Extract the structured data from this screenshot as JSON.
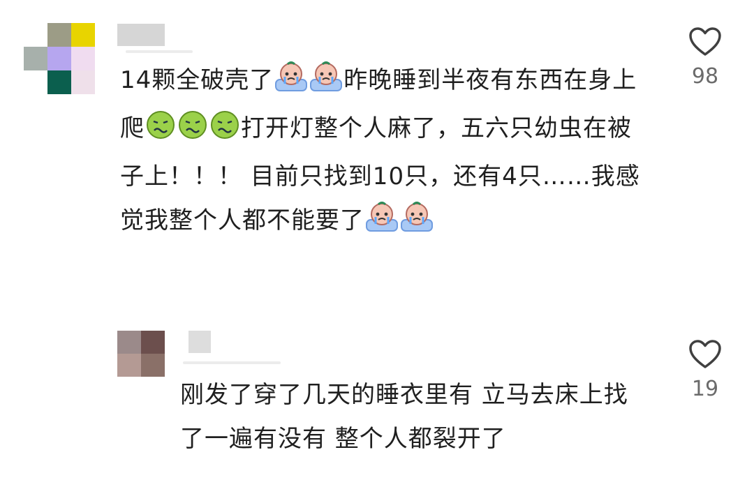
{
  "comments": [
    {
      "text_parts": [
        "14颗全破壳了",
        "昨晚睡到半夜有东西在身上爬",
        "打开灯整个人麻了，五六只幼虫在被子上！！！ 目前只找到10只，还有4只……我感觉我整个人都不能要了"
      ],
      "like_count": "98",
      "icons": {
        "emoji_a": "crying-baby-emoji",
        "emoji_b": "nauseated-face-emoji",
        "like": "heart-outline-icon"
      },
      "colors": {
        "avatar": [
          "#9c9c86",
          "#e8d400",
          "#a7b0ab",
          "#b6a6ef",
          "#f0dcf0",
          "#0b5f4e",
          "#efe0ea"
        ]
      }
    },
    {
      "text_parts": [
        "刚发了穿了几天的睡衣里有 立马去床上找了一遍有没有 整个人都裂开了"
      ],
      "like_count": "19",
      "icons": {
        "like": "heart-outline-icon"
      },
      "colors": {
        "avatar": [
          "#9b8a8a",
          "#6c4f4d",
          "#b49a94",
          "#8a7068"
        ]
      }
    }
  ]
}
